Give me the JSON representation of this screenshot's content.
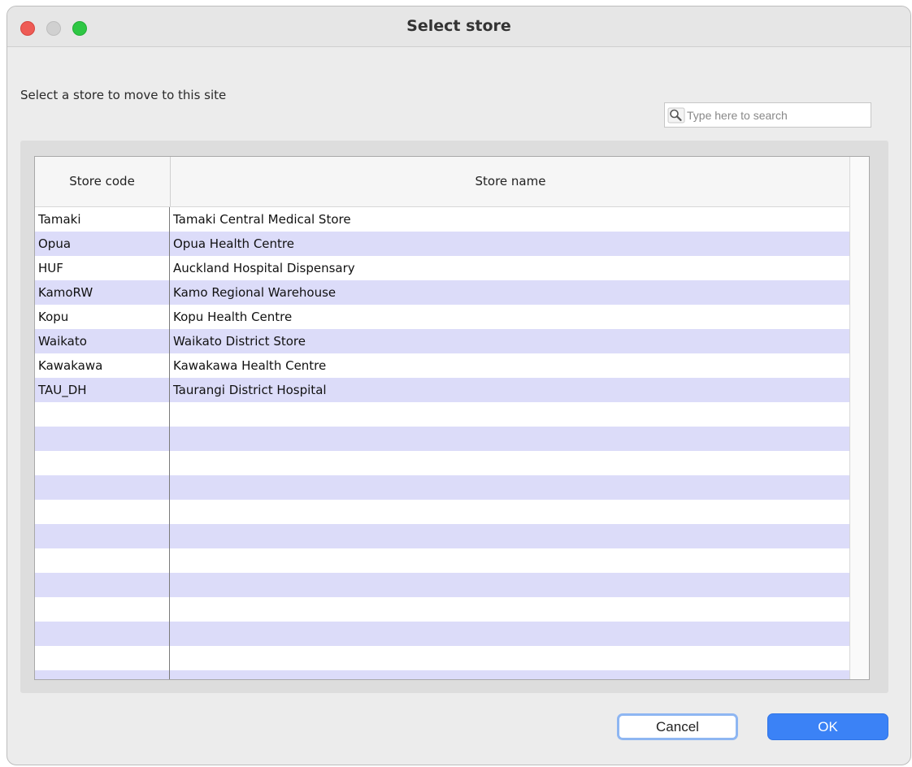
{
  "window": {
    "title": "Select store"
  },
  "prompt": "Select a store to move to this site",
  "search": {
    "placeholder": "Type here to search",
    "icon": "search-icon"
  },
  "table": {
    "columns": [
      "Store code",
      "Store name"
    ],
    "rows": [
      {
        "code": "Tamaki",
        "name": "Tamaki Central Medical Store"
      },
      {
        "code": "Opua",
        "name": "Opua Health Centre"
      },
      {
        "code": "HUF",
        "name": "Auckland Hospital Dispensary"
      },
      {
        "code": "KamoRW",
        "name": "Kamo Regional Warehouse"
      },
      {
        "code": "Kopu",
        "name": "Kopu Health Centre"
      },
      {
        "code": "Waikato",
        "name": "Waikato District Store"
      },
      {
        "code": "Kawakawa",
        "name": "Kawakawa Health Centre"
      },
      {
        "code": "TAU_DH",
        "name": "Taurangi District Hospital"
      }
    ]
  },
  "buttons": {
    "cancel": "Cancel",
    "ok": "OK"
  },
  "colors": {
    "row_alt": "#dcdcf9",
    "ok_button": "#3b82f6",
    "cancel_border": "#8eb6f2"
  }
}
